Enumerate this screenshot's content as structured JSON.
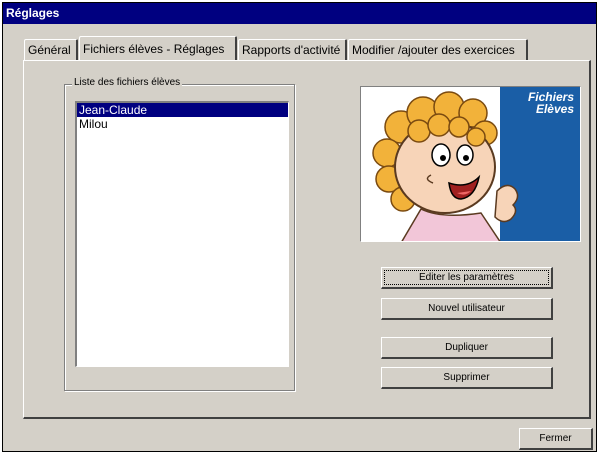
{
  "window": {
    "title": "Réglages"
  },
  "tabs": [
    {
      "label": "Général"
    },
    {
      "label": "Fichiers élèves - Réglages"
    },
    {
      "label": "Rapports d'activité"
    },
    {
      "label": "Modifier /ajouter des exercices"
    }
  ],
  "active_tab": 1,
  "student_files": {
    "group_label": "Liste des fichiers élèves",
    "items": [
      {
        "label": "Jean-Claude",
        "selected": true
      },
      {
        "label": "Milou",
        "selected": false
      }
    ]
  },
  "illustration": {
    "line1": "Fichiers",
    "line2": "Elèves"
  },
  "buttons": {
    "edit": "Editer les paramètres",
    "new_user": "Nouvel utilisateur",
    "duplicate": "Dupliquer",
    "delete": "Supprimer",
    "close": "Fermer"
  },
  "colors": {
    "titlebar": "#000080",
    "selection": "#000080",
    "face": "#d4d0c8",
    "banner": "#1a5ea6"
  }
}
